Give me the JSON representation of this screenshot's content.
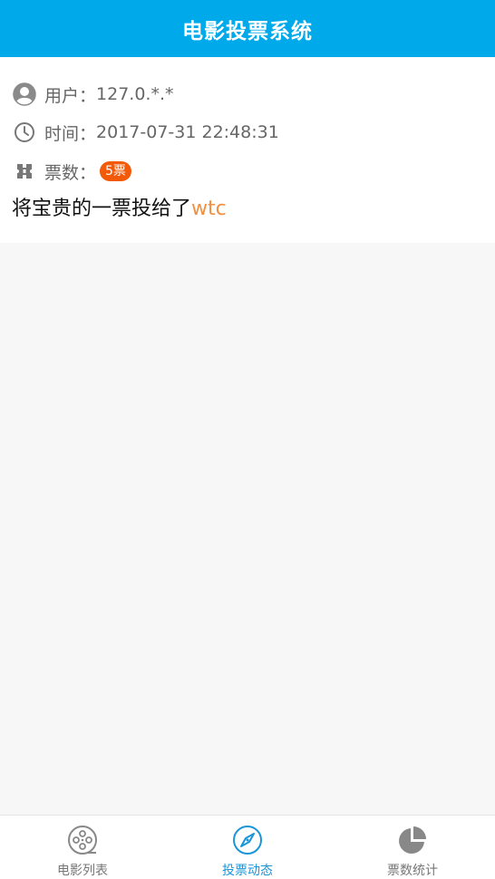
{
  "header": {
    "title": "电影投票系统"
  },
  "vote_record": {
    "user_label": "用户：",
    "user_value": "127.0.*.*",
    "time_label": "时间：",
    "time_value": "2017-07-31 22:48:31",
    "votes_label": "票数：",
    "votes_badge": "5票",
    "message_prefix": "将宝贵的一票投给了",
    "movie_name": "wtc",
    "icons": [
      "user-avatar-icon",
      "clock-icon",
      "ticket-icon"
    ]
  },
  "tabbar": {
    "tabs": [
      {
        "label": "电影列表",
        "icon": "film-reel-icon",
        "active": false
      },
      {
        "label": "投票动态",
        "icon": "compass-icon",
        "active": true
      },
      {
        "label": "票数统计",
        "icon": "pie-chart-icon",
        "active": false
      }
    ]
  },
  "colors": {
    "header_bg": "#00a9ea",
    "badge_bg": "#f25a0a",
    "movie_name": "#f09042",
    "active_tab": "#1a96d8",
    "inactive_tab": "#777777"
  }
}
